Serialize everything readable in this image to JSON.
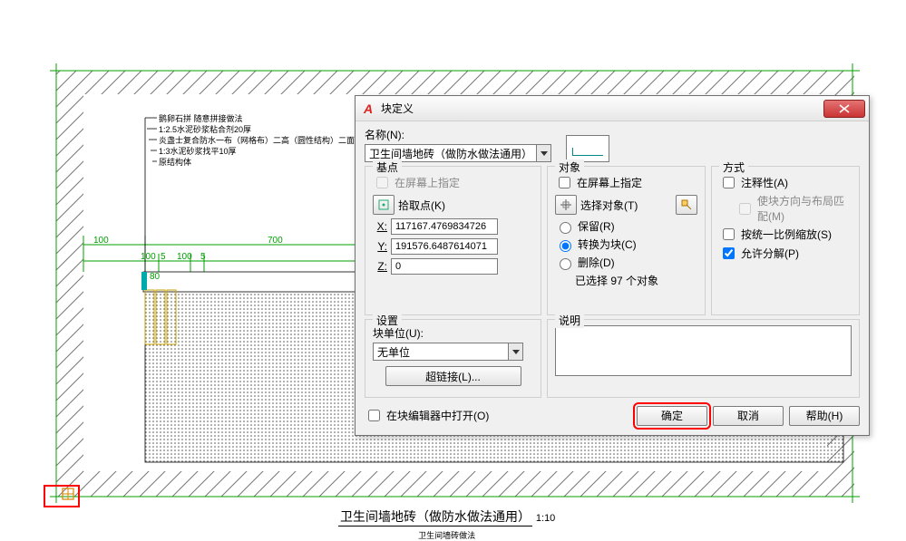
{
  "drawing": {
    "notes": [
      "鹅卵石拼 随意拼接做法",
      "1:2.5水泥砂浆粘合剂20厚",
      "炎盏士复合防水一布（网格布）二高（圆性结构）二面（柔性结构）",
      "1:3水泥砂浆找平10厚",
      "原结构体"
    ],
    "dims": {
      "d100a": "100",
      "d700": "700",
      "d100b": "100",
      "d5a": "5",
      "d100c": "100",
      "d5b": "5",
      "d80": "80"
    },
    "title_main": "卫生间墙地砖（做防水做法通用）",
    "title_scale": "1:10",
    "title_sub": "卫生间墙砖做法"
  },
  "dlg": {
    "title": "块定义",
    "name_label": "名称(N):",
    "name_value": "卫生间墙地砖（做防水做法通用）",
    "g_base": "基点",
    "chk_screen1": "在屏幕上指定",
    "btn_pick": "拾取点(K)",
    "x_label": "X:",
    "x_val": "117167.4769834726",
    "y_label": "Y:",
    "y_val": "191576.6487614071",
    "z_label": "Z:",
    "z_val": "0",
    "g_obj": "对象",
    "chk_screen2": "在屏幕上指定",
    "btn_select": "选择对象(T)",
    "r_keep": "保留(R)",
    "r_convert": "转换为块(C)",
    "r_delete": "删除(D)",
    "count": "已选择 97 个对象",
    "g_mode": "方式",
    "m_annot": "注释性(A)",
    "m_match": "使块方向与布局匹配(M)",
    "m_scale": "按统一比例缩放(S)",
    "m_explode": "允许分解(P)",
    "g_set": "设置",
    "unit_lbl": "块单位(U):",
    "unit_val": "无单位",
    "btn_hyper": "超链接(L)...",
    "g_desc": "说明",
    "desc_val": "",
    "chk_openeditor": "在块编辑器中打开(O)",
    "btn_ok": "确定",
    "btn_cancel": "取消",
    "btn_help": "帮助(H)"
  }
}
